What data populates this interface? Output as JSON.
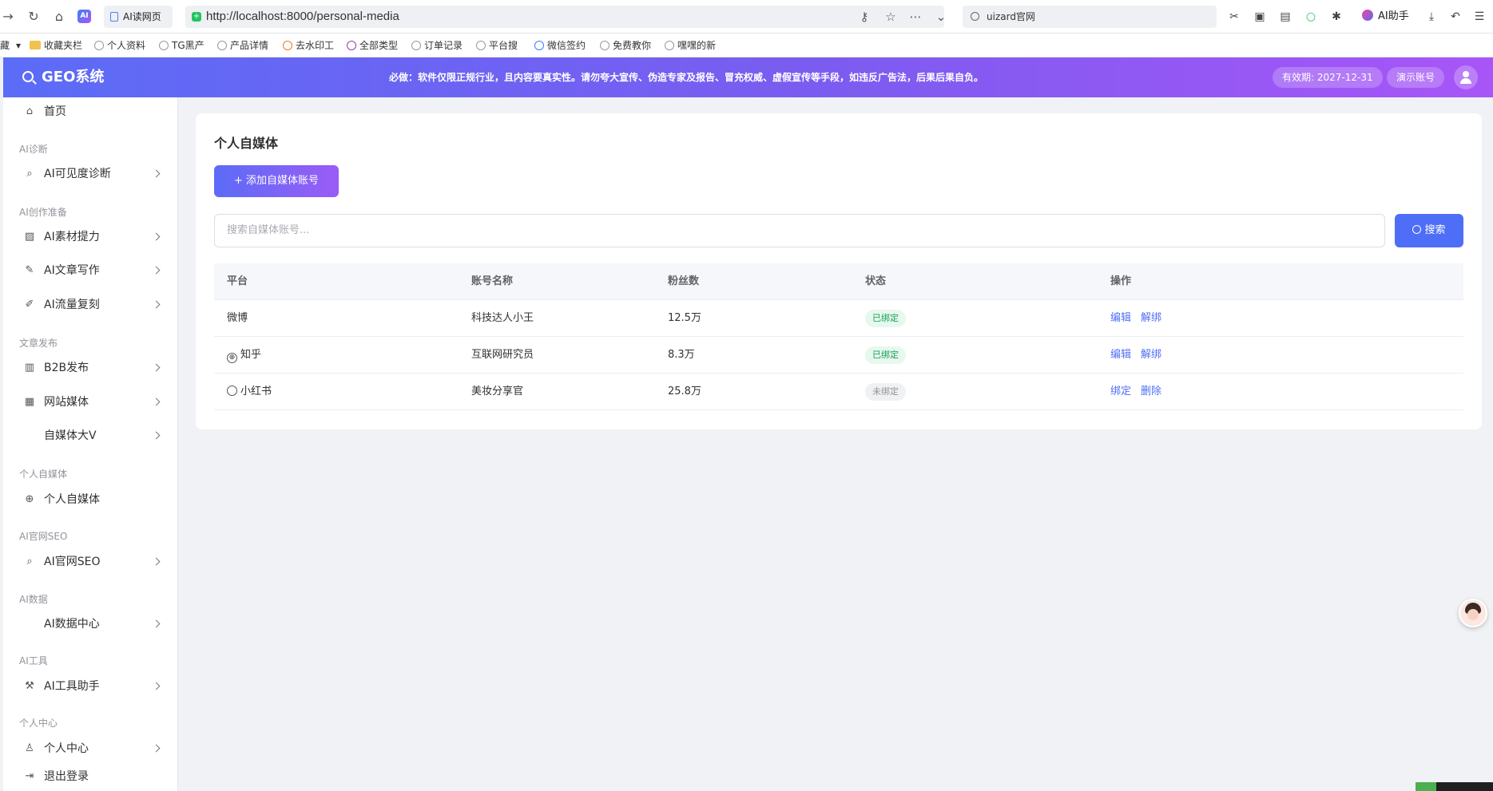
{
  "browser": {
    "tab_title": "AI读网页",
    "url": "http://localhost:8000/personal-media",
    "search_text": "uizard官网",
    "ai_assistant": "AI助手",
    "bookmarks": [
      "藏",
      "收藏夹栏",
      "个人资料",
      "TG黑产",
      "产品详情",
      "去水印工",
      "全部类型",
      "订单记录",
      "平台搜",
      "微信签约",
      "免费教你",
      "嘿嘿的新"
    ]
  },
  "header": {
    "logo": "GEO系统",
    "notice": "必做：软件仅限正规行业，且内容要真实性。请勿夸大宣传、伪造专家及报告、冒充权威、虚假宣传等手段，如违反广告法，后果后果自负。",
    "validity": "有效期: 2027-12-31",
    "demo_account": "演示账号"
  },
  "sidebar": {
    "home": "首页",
    "groups": {
      "diag": "AI诊断",
      "prep": "AI创作准备",
      "publish": "文章发布",
      "self_media": "个人自媒体",
      "seo": "AI官网SEO",
      "data": "AI数据",
      "tools": "AI工具",
      "personal": "个人中心"
    },
    "items": {
      "visibility": "AI可见度诊断",
      "material": "AI素材提力",
      "writing": "AI文章写作",
      "traffic": "AI流量复刻",
      "b2b": "B2B发布",
      "website_media": "网站媒体",
      "big_v": "自媒体大V",
      "personal_media": "个人自媒体",
      "site_seo": "AI官网SEO",
      "data_center": "AI数据中心",
      "tool_helper": "AI工具助手",
      "user_center": "个人中心",
      "logout": "退出登录"
    }
  },
  "main": {
    "title": "个人自媒体",
    "add_button": "+ 添加自媒体账号",
    "search_placeholder": "搜索自媒体账号...",
    "search_button": "搜索",
    "columns": [
      "平台",
      "账号名称",
      "粉丝数",
      "状态",
      "操作"
    ],
    "rows": [
      {
        "platform": "微博",
        "name": "科技达人小王",
        "fans": "12.5万",
        "status": "已绑定",
        "op1": "编辑",
        "op2": "解绑"
      },
      {
        "platform": "知乎",
        "name": "互联网研究员",
        "fans": "8.3万",
        "status": "已绑定",
        "op1": "编辑",
        "op2": "解绑"
      },
      {
        "platform": "小红书",
        "name": "美妆分享官",
        "fans": "25.8万",
        "status": "未绑定",
        "op1": "绑定",
        "op2": "删除"
      }
    ]
  },
  "colors": {
    "header_gradient_start": "#5b6cf6",
    "header_gradient_end": "#a855f7",
    "primary": "#4f6ef7",
    "bound": "#18a058"
  }
}
